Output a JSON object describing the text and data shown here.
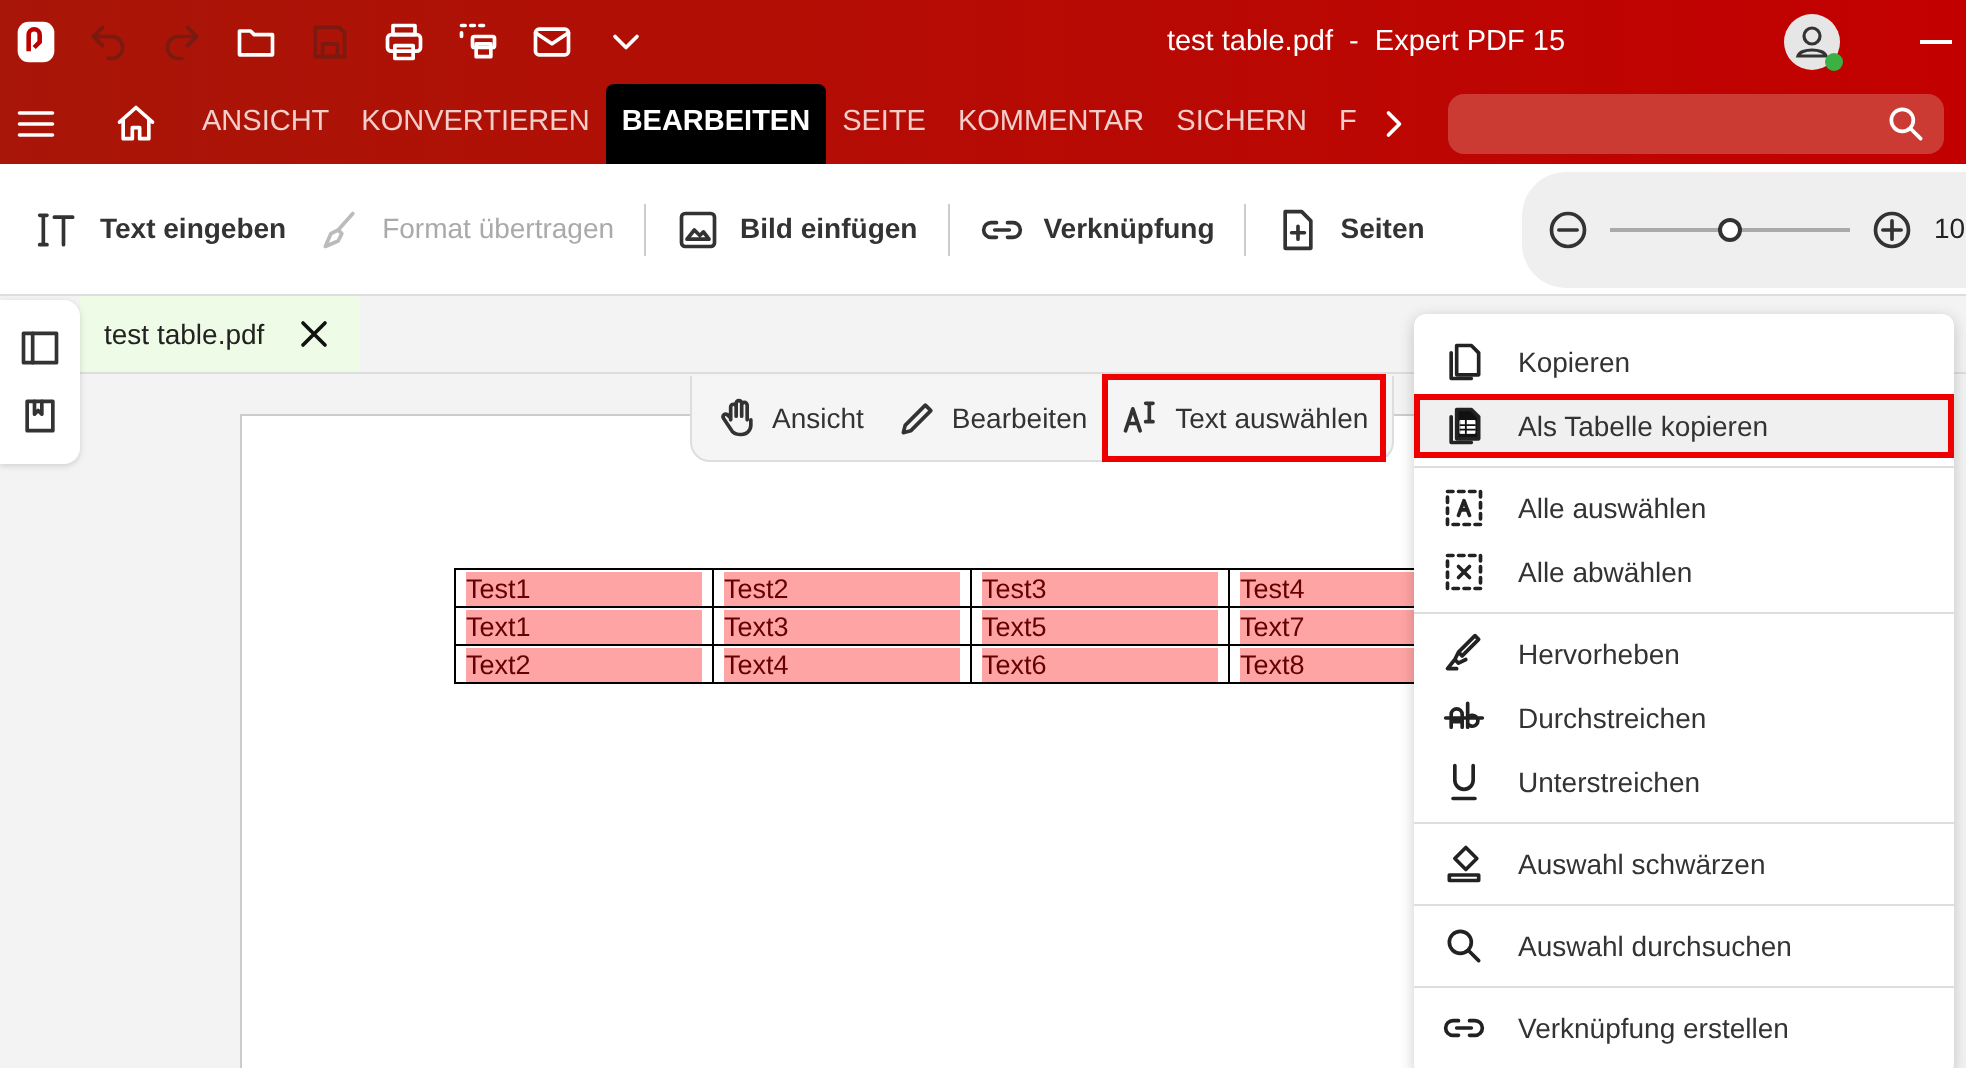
{
  "window": {
    "title": "test table.pdf  -  Expert PDF 15"
  },
  "menu_tabs": [
    {
      "label": "ANSICHT",
      "selected": false
    },
    {
      "label": "KONVERTIEREN",
      "selected": false
    },
    {
      "label": "BEARBEITEN",
      "selected": true
    },
    {
      "label": "SEITE",
      "selected": false
    },
    {
      "label": "KOMMENTAR",
      "selected": false
    },
    {
      "label": "SICHERN",
      "selected": false
    },
    {
      "label": "F",
      "selected": false
    }
  ],
  "toolbar": [
    {
      "label": "Text eingeben",
      "disabled": false
    },
    {
      "label": "Format übertragen",
      "disabled": true
    },
    {
      "label": "Bild einfügen",
      "disabled": false
    },
    {
      "label": "Verknüpfung",
      "disabled": false
    },
    {
      "label": "Seiten",
      "disabled": false
    }
  ],
  "zoom": {
    "level": 0.5,
    "reading": "10"
  },
  "document_tab": {
    "label": "test table.pdf"
  },
  "tools": [
    {
      "label": "Ansicht",
      "highlighted": false
    },
    {
      "label": "Bearbeiten",
      "highlighted": false
    },
    {
      "label": "Text auswählen",
      "highlighted": true
    }
  ],
  "table": {
    "rows": [
      [
        "Test1",
        "Test2",
        "Test3",
        "Test4"
      ],
      [
        "Text1",
        "Text3",
        "Text5",
        "Text7"
      ],
      [
        "Text2",
        "Text4",
        "Text6",
        "Text8"
      ]
    ]
  },
  "context_menu": {
    "groups": [
      [
        {
          "label": "Kopieren",
          "selected": false,
          "highlighted": false
        },
        {
          "label": "Als Tabelle kopieren",
          "selected": true,
          "highlighted": true
        }
      ],
      [
        {
          "label": "Alle auswählen",
          "selected": false,
          "highlighted": false
        },
        {
          "label": "Alle abwählen",
          "selected": false,
          "highlighted": false
        }
      ],
      [
        {
          "label": "Hervorheben",
          "selected": false,
          "highlighted": false
        },
        {
          "label": "Durchstreichen",
          "selected": false,
          "highlighted": false
        },
        {
          "label": "Unterstreichen",
          "selected": false,
          "highlighted": false
        }
      ],
      [
        {
          "label": "Auswahl schwärzen",
          "selected": false,
          "highlighted": false
        }
      ],
      [
        {
          "label": "Auswahl durchsuchen",
          "selected": false,
          "highlighted": false
        }
      ],
      [
        {
          "label": "Verknüpfung erstellen",
          "selected": false,
          "highlighted": false
        }
      ]
    ]
  }
}
